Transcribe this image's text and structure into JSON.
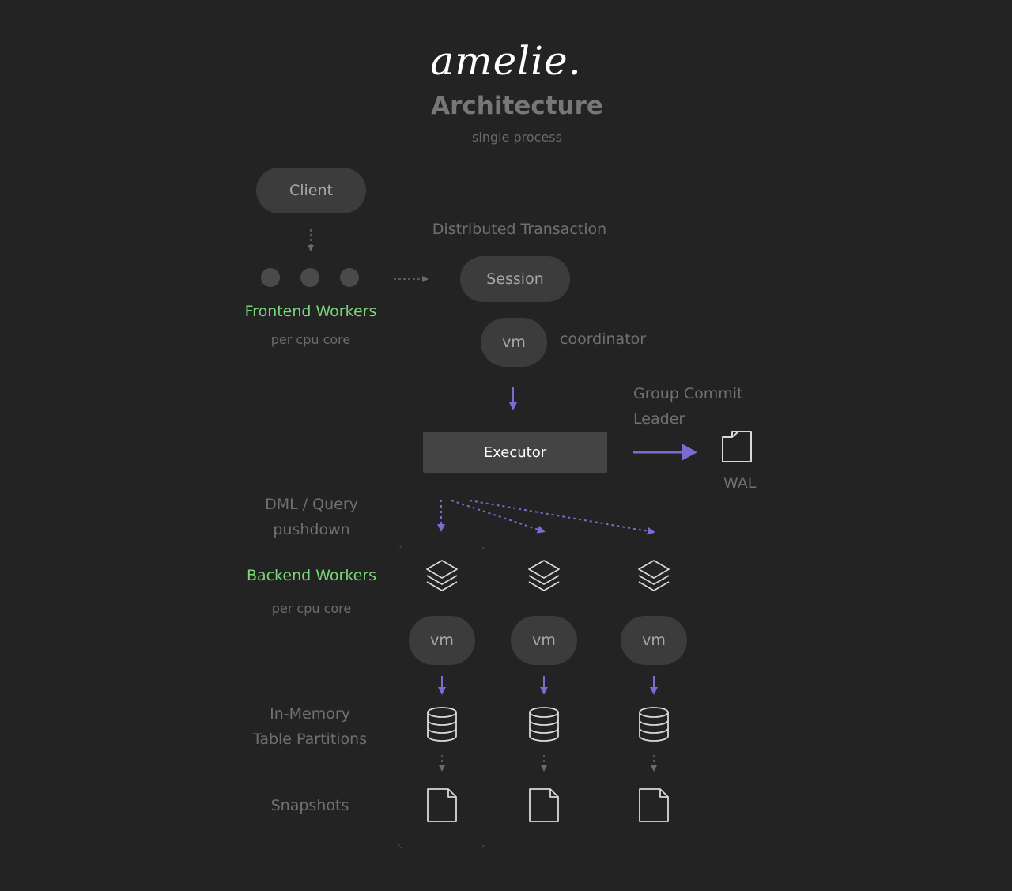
{
  "header": {
    "logo_text": "amelie.",
    "title": "Architecture",
    "subtitle": "single process"
  },
  "client": {
    "label": "Client"
  },
  "frontend": {
    "label": "Frontend Workers",
    "sub": "per cpu core",
    "worker_count": 3
  },
  "transaction": {
    "label": "Distributed Transaction",
    "session_label": "Session",
    "vm_label": "vm",
    "coordinator_label": "coordinator"
  },
  "executor": {
    "label": "Executor"
  },
  "wal": {
    "group_commit_line1": "Group Commit",
    "group_commit_line2": "Leader",
    "label": "WAL"
  },
  "pushdown": {
    "line1": "DML / Query",
    "line2": "pushdown"
  },
  "backend": {
    "label": "Backend Workers",
    "sub": "per cpu core",
    "columns": [
      {
        "vm_label": "vm"
      },
      {
        "vm_label": "vm"
      },
      {
        "vm_label": "vm"
      }
    ]
  },
  "storage": {
    "in_memory_line1": "In-Memory",
    "in_memory_line2": "Table Partitions",
    "snapshots_label": "Snapshots"
  },
  "colors": {
    "background": "#232323",
    "accent_green": "#7ad67a",
    "accent_purple": "#7d6bd1",
    "pill": "#3c3c3c",
    "icon_stroke": "#d8d8d8"
  }
}
